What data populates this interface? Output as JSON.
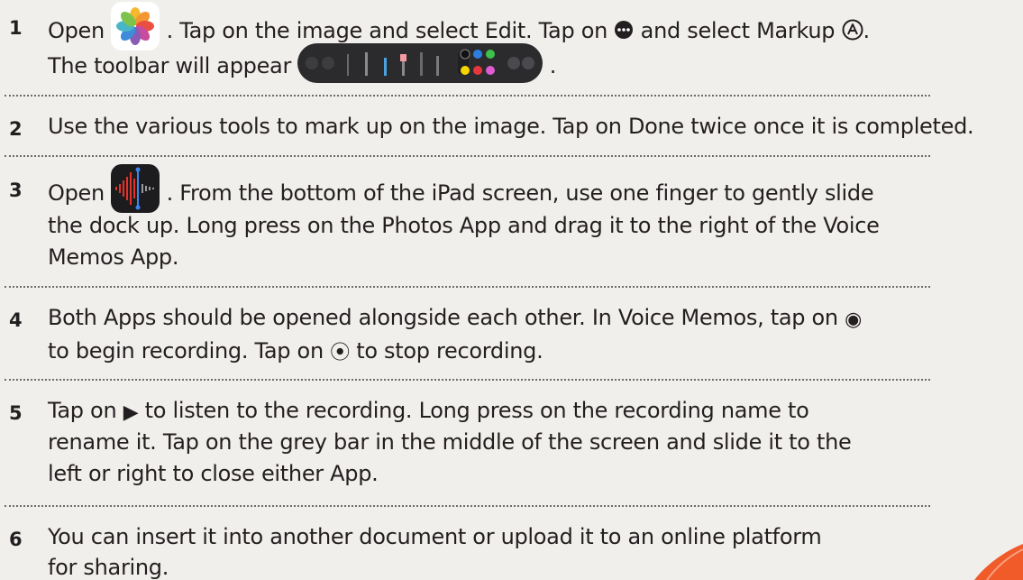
{
  "steps": [
    {
      "number": "1",
      "lines": [
        {
          "t1": "Open ",
          "t2": " . Tap on the image and select Edit. Tap on ",
          "t3": " and select Markup ",
          "t4": "."
        },
        {
          "t1": "The toolbar will appear ",
          "t2": " ."
        }
      ],
      "icons": {
        "photos": "photos-app-icon",
        "more": "ellipsis-circle-icon",
        "markup": "markup-pen-icon",
        "toolbar": "markup-toolbar-image"
      }
    },
    {
      "number": "2",
      "lines": [
        {
          "t1": "Use the various tools to mark up on the image. Tap on Done twice once it is completed."
        }
      ]
    },
    {
      "number": "3",
      "lines": [
        {
          "t1": "Open ",
          "t2": " . From the bottom of the iPad screen, use one finger to gently slide"
        },
        {
          "t1": "the dock up. Long press on the Photos App and drag it to the right of the Voice"
        },
        {
          "t1": "Memos App."
        }
      ],
      "icons": {
        "voice_memos": "voice-memos-app-icon"
      }
    },
    {
      "number": "4",
      "lines": [
        {
          "t1": "Both Apps should be opened alongside each other. In Voice Memos, tap on ",
          "glyph": "◉"
        },
        {
          "t1": "to begin recording. Tap on ",
          "glyph": "⦿",
          "t2": " to stop recording."
        }
      ],
      "icons": {
        "record": "record-button-icon",
        "stop": "stop-button-icon"
      }
    },
    {
      "number": "5",
      "lines": [
        {
          "t1": "Tap on ",
          "glyph": "▶",
          "t2": " to listen to the recording. Long press on the recording name to"
        },
        {
          "t1": "rename it. Tap on the grey bar in the middle of the screen and slide it to the"
        },
        {
          "t1": "left or right to close either App."
        }
      ],
      "icons": {
        "play": "play-icon"
      }
    },
    {
      "number": "6",
      "lines": [
        {
          "t1": "You can insert it into another document or upload it to an online platform"
        },
        {
          "t1": "for sharing."
        }
      ]
    }
  ],
  "colors": {
    "background": "#f1efec",
    "text": "#231f20",
    "accent": "#f15a29"
  }
}
